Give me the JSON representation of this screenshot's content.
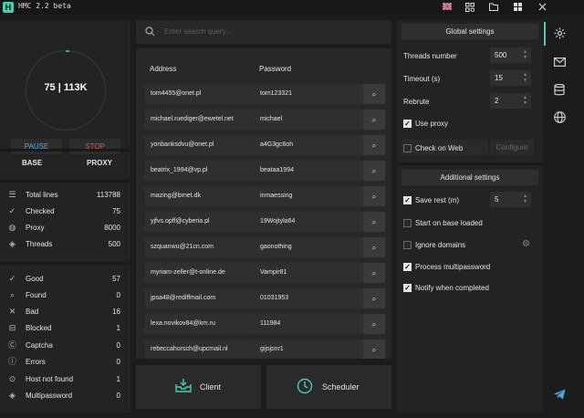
{
  "app": {
    "title": "HMC 2.2 beta",
    "logo": "H"
  },
  "titlebar": {
    "flag_icon": "uk-flag-icon",
    "grid_icon": "grid-icon",
    "folder_icon": "folder-icon",
    "windows_icon": "windows-icon",
    "close_icon": "close-icon"
  },
  "progress": {
    "label": "75 | 113K"
  },
  "controls": {
    "pause": "PAUSE",
    "stop": "STOP",
    "pause_color": "#56a7d6",
    "stop_color": "#e0584d"
  },
  "left_tabs": {
    "base": "BASE",
    "proxy": "PROXY"
  },
  "stats": [
    {
      "icon": "list-icon",
      "label": "Total lines",
      "value": "113788"
    },
    {
      "icon": "check-circle-icon",
      "label": "Checked",
      "value": "75"
    },
    {
      "icon": "globe-icon",
      "label": "Proxy",
      "value": "8000"
    },
    {
      "icon": "layers-icon",
      "label": "Threads",
      "value": "500"
    }
  ],
  "results": [
    {
      "icon": "check-icon",
      "label": "Good",
      "value": "57"
    },
    {
      "icon": "search-icon",
      "label": "Found",
      "value": "0"
    },
    {
      "icon": "x-icon",
      "label": "Bad",
      "value": "16"
    },
    {
      "icon": "lock-icon",
      "label": "Blocked",
      "value": "1"
    },
    {
      "icon": "captcha-icon",
      "label": "Captcha",
      "value": "0"
    },
    {
      "icon": "error-icon",
      "label": "Errors",
      "value": "0"
    },
    {
      "icon": "host-icon",
      "label": "Host not found",
      "value": "1"
    },
    {
      "icon": "layers-icon",
      "label": "Multipassword",
      "value": "0"
    }
  ],
  "search": {
    "placeholder": "Enter search query..."
  },
  "table": {
    "columns": [
      "Address",
      "Password"
    ],
    "rows": [
      {
        "email": "tom4455@onet.pl",
        "password": "tom123321"
      },
      {
        "email": "michael.ruediger@ewetel.net",
        "password": "michael"
      },
      {
        "email": "yonbanksdvu@onet.pl",
        "password": "a4G3gc6oh"
      },
      {
        "email": "beatrix_1994@vp.pl",
        "password": "beataa1994"
      },
      {
        "email": "mazing@brnet.dk",
        "password": "inmaessing"
      },
      {
        "email": "yjfvs.opff@cyberia.pl",
        "password": "19Wojtyla64"
      },
      {
        "email": "szquanwu@21cn.com",
        "password": "gaonothing"
      },
      {
        "email": "myriam-zeller@t-online.de",
        "password": "Vampir81"
      },
      {
        "email": "jpsa48@rediffmail.com",
        "password": "01031953"
      },
      {
        "email": "lexa.novikov84@km.ru",
        "password": "111984"
      },
      {
        "email": "rebeccahorsch@upcmail.nl",
        "password": "gijsjsnr1"
      }
    ]
  },
  "bottom": {
    "client": "Client",
    "scheduler": "Scheduler"
  },
  "settings": {
    "global_title": "Global settings",
    "threads_label": "Threads number",
    "threads_value": "500",
    "timeout_label": "Timeout (s)",
    "timeout_value": "15",
    "rebrute_label": "Rebrute",
    "rebrute_value": "2",
    "use_proxy": "Use proxy",
    "check_web": "Check on Web",
    "configure": "Configure",
    "additional_title": "Additional settings",
    "save_rest": "Save rest (m)",
    "save_rest_value": "5",
    "start_on_base": "Start on base loaded",
    "ignore_domains": "Ignore domains",
    "process_multi": "Process multipassword",
    "notify": "Notify when completed"
  },
  "accent": "#3fd3b3"
}
